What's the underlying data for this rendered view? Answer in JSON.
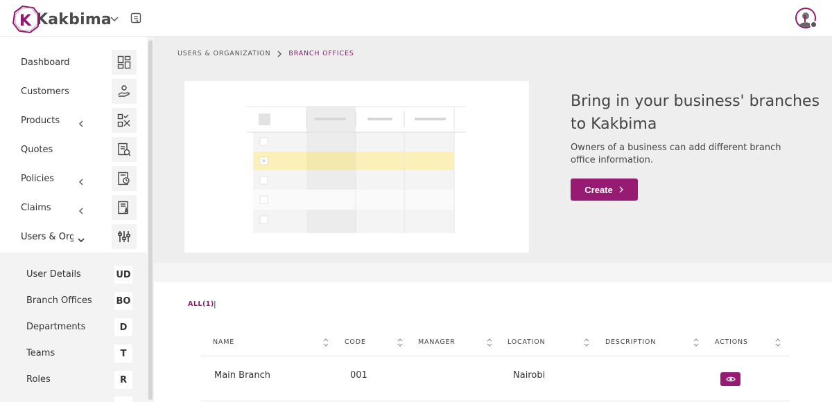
{
  "header": {
    "logo_text": "Kakbima",
    "brand_color": "#981b73"
  },
  "sidebar": {
    "items": [
      {
        "label": "Dashboard",
        "icon": "dashboard-icon",
        "has_caret": false
      },
      {
        "label": "Customers",
        "icon": "customers-icon",
        "has_caret": false
      },
      {
        "label": "Products",
        "icon": "products-icon",
        "has_caret": true
      },
      {
        "label": "Quotes",
        "icon": "quotes-icon",
        "has_caret": false
      },
      {
        "label": "Policies",
        "icon": "policies-icon",
        "has_caret": true
      },
      {
        "label": "Claims",
        "icon": "claims-icon",
        "has_caret": true
      },
      {
        "label": "Users & Organization",
        "icon": "users-org-icon",
        "has_caret": true,
        "expanded": true
      }
    ],
    "submenu": [
      {
        "label": "User Details",
        "abbr": "UD"
      },
      {
        "label": "Branch Offices",
        "abbr": "BO"
      },
      {
        "label": "Departments",
        "abbr": "D"
      },
      {
        "label": "Teams",
        "abbr": "T"
      },
      {
        "label": "Roles",
        "abbr": "R"
      }
    ]
  },
  "breadcrumb": {
    "parent": "USERS & ORGANIZATION",
    "current": "BRANCH OFFICES"
  },
  "hero": {
    "title": "Bring in your business' branches to Kakbima",
    "description": "Owners of a business can add different branch office information.",
    "create_label": "Create"
  },
  "filters": {
    "all_label": "ALL(1)",
    "separator": "|"
  },
  "table": {
    "columns": [
      "NAME",
      "CODE",
      "MANAGER",
      "LOCATION",
      "DESCRIPTION",
      "ACTIONS"
    ],
    "rows": [
      {
        "name": "Main Branch",
        "code": "001",
        "manager": "",
        "location": "Nairobi",
        "description": ""
      }
    ]
  }
}
